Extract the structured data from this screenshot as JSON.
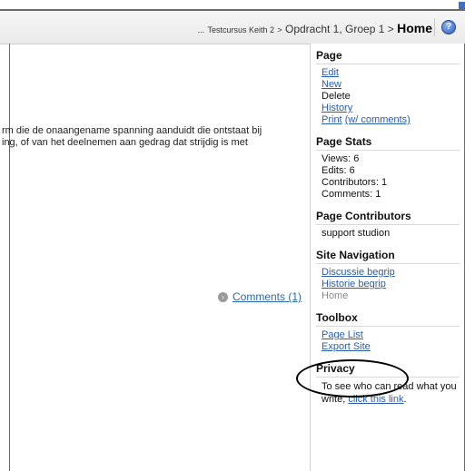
{
  "breadcrumb": {
    "ellipsis": "...",
    "course": "Testcursus Keith 2",
    "sep1": ">",
    "assignment": "Opdracht 1, Groep 1",
    "sep2": ">",
    "current": "Home"
  },
  "help_icon_label": "?",
  "content": {
    "line1": "rm die de onaangename spanning aanduidt die ontstaat bij",
    "line2": "ing, of van het deelnemen aan gedrag dat strijdig is met"
  },
  "comments_link": "Comments (1)",
  "sidebar": {
    "page": {
      "title": "Page",
      "edit": "Edit",
      "new": "New",
      "delete": "Delete",
      "history": "History",
      "print": "Print",
      "print_comments": "(w/ comments)"
    },
    "page_stats": {
      "title": "Page Stats",
      "views": "Views: 6",
      "edits": "Edits: 6",
      "contributors": "Contributors: 1",
      "comments": "Comments: 1"
    },
    "page_contributors": {
      "title": "Page Contributors",
      "user": "support studion"
    },
    "site_navigation": {
      "title": "Site Navigation",
      "discussie": "Discussie begrip",
      "historie": "Historie begrip",
      "home": "Home"
    },
    "toolbox": {
      "title": "Toolbox",
      "page_list": "Page List",
      "export_site": "Export Site"
    },
    "privacy": {
      "title": "Privacy",
      "text": "To see who can read what you write,",
      "link": "click this link"
    }
  },
  "colors": {
    "link": "#2a5ea8",
    "annotation_ellipse": "#000000"
  }
}
